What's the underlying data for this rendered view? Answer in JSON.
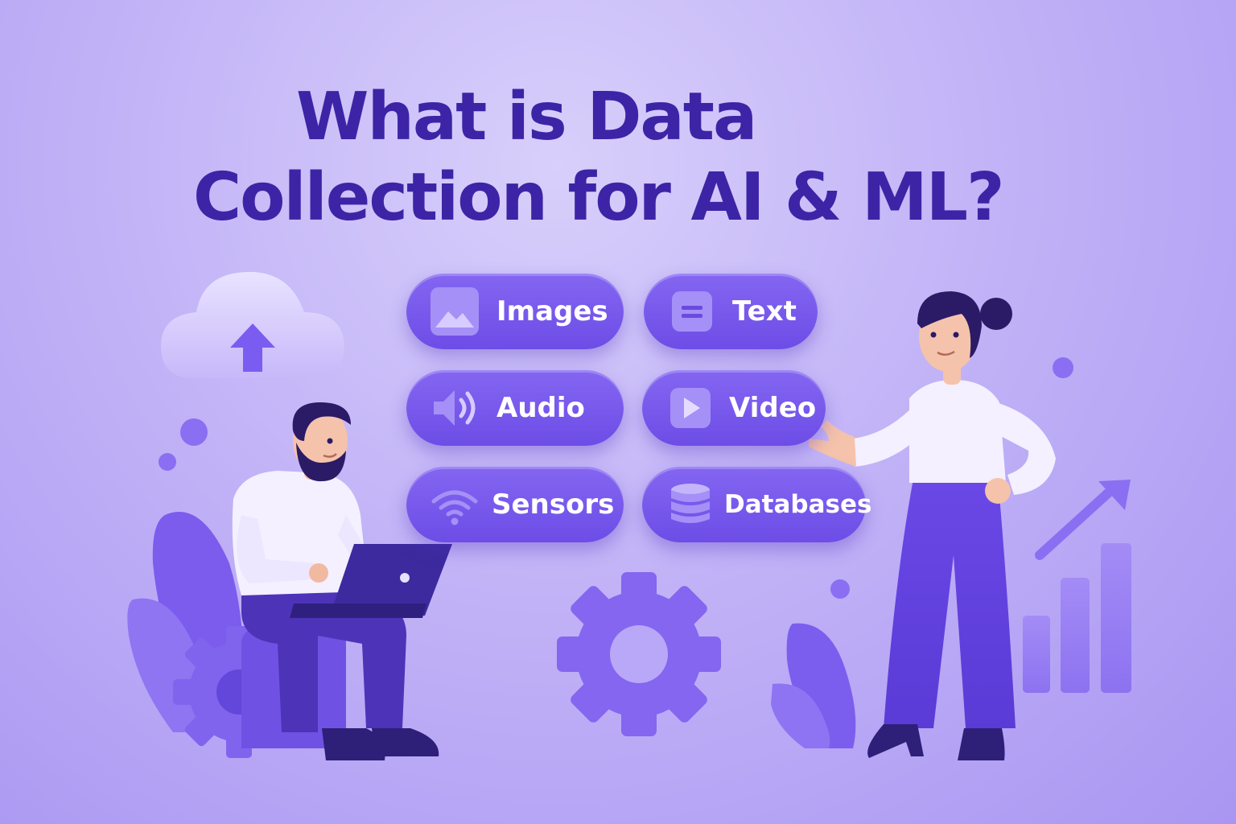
{
  "title": {
    "line1": "What is Data",
    "line2": "Collection for AI & ML?"
  },
  "pills": [
    {
      "label": "Images",
      "icon": "image-icon"
    },
    {
      "label": "Text",
      "icon": "text-icon"
    },
    {
      "label": "Audio",
      "icon": "audio-icon"
    },
    {
      "label": "Video",
      "icon": "video-icon"
    },
    {
      "label": "Sensors",
      "icon": "sensors-icon"
    },
    {
      "label": "Databases",
      "icon": "database-icon"
    }
  ],
  "colors": {
    "background": "#c2b3f7",
    "title": "#3d24a6",
    "pill": "#7657ec",
    "accent": "#6a4ae0",
    "shirt": "#f4f0ff"
  }
}
